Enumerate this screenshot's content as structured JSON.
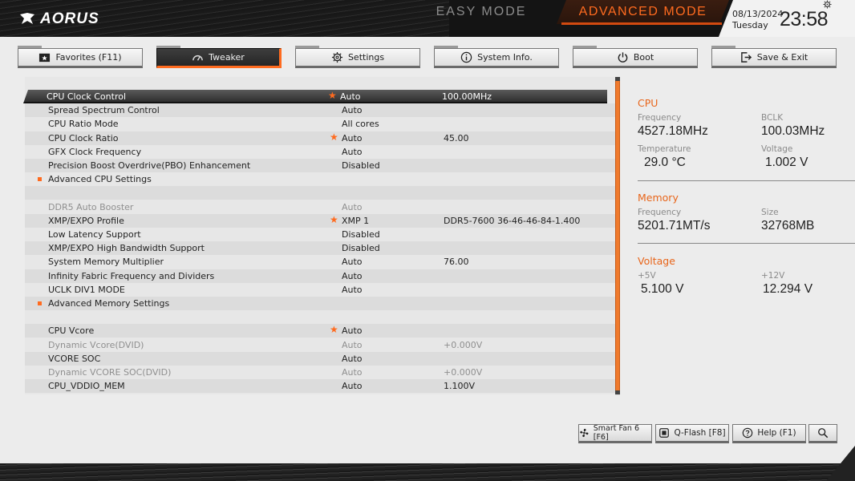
{
  "header": {
    "brand": "AORUS",
    "easy_mode_label": "EASY MODE",
    "advanced_mode_label": "ADVANCED MODE",
    "date": "08/13/2024",
    "weekday": "Tuesday",
    "time": "23:58"
  },
  "tabs": [
    {
      "label": "Favorites (F11)",
      "icon": "star-folder-icon"
    },
    {
      "label": "Tweaker",
      "icon": "gauge-icon",
      "active": true
    },
    {
      "label": "Settings",
      "icon": "gear-icon"
    },
    {
      "label": "System Info.",
      "icon": "info-icon"
    },
    {
      "label": "Boot",
      "icon": "power-icon"
    },
    {
      "label": "Save & Exit",
      "icon": "exit-icon"
    }
  ],
  "settings": [
    {
      "label": "CPU Clock Control",
      "value": "Auto",
      "extra": "100.00MHz",
      "star": true,
      "selected": true
    },
    {
      "label": "Spread Spectrum Control",
      "value": "Auto",
      "extra": ""
    },
    {
      "label": "CPU Ratio Mode",
      "value": "All cores",
      "extra": ""
    },
    {
      "label": "CPU Clock Ratio",
      "value": "Auto",
      "extra": "45.00",
      "star": true
    },
    {
      "label": "GFX Clock Frequency",
      "value": "Auto",
      "extra": ""
    },
    {
      "label": "Precision Boost Overdrive(PBO) Enhancement",
      "value": "Disabled",
      "extra": ""
    },
    {
      "label": "Advanced CPU Settings",
      "value": "",
      "extra": "",
      "submenu": true
    },
    {
      "label": "",
      "value": "",
      "extra": ""
    },
    {
      "label": "DDR5 Auto Booster",
      "value": "Auto",
      "extra": "",
      "dim": true
    },
    {
      "label": "XMP/EXPO Profile",
      "value": "XMP 1",
      "extra": "DDR5-7600 36-46-46-84-1.400",
      "star": true
    },
    {
      "label": "Low Latency Support",
      "value": "Disabled",
      "extra": ""
    },
    {
      "label": "XMP/EXPO High Bandwidth Support",
      "value": "Disabled",
      "extra": ""
    },
    {
      "label": "System Memory Multiplier",
      "value": "Auto",
      "extra": "76.00"
    },
    {
      "label": "Infinity Fabric Frequency and Dividers",
      "value": "Auto",
      "extra": ""
    },
    {
      "label": "UCLK DIV1 MODE",
      "value": "Auto",
      "extra": ""
    },
    {
      "label": "Advanced Memory Settings",
      "value": "",
      "extra": "",
      "submenu": true
    },
    {
      "label": "",
      "value": "",
      "extra": ""
    },
    {
      "label": "CPU Vcore",
      "value": "Auto",
      "extra": "",
      "star": true
    },
    {
      "label": "Dynamic Vcore(DVID)",
      "value": "Auto",
      "extra": "+0.000V",
      "dim": true
    },
    {
      "label": "VCORE SOC",
      "value": "Auto",
      "extra": ""
    },
    {
      "label": "Dynamic VCORE SOC(DVID)",
      "value": "Auto",
      "extra": "+0.000V",
      "dim": true
    },
    {
      "label": "CPU_VDDIO_MEM",
      "value": "Auto",
      "extra": "1.100V"
    }
  ],
  "monitor": {
    "cpu": {
      "title": "CPU",
      "frequency_label": "Frequency",
      "frequency": "4527.18MHz",
      "bclk_label": "BCLK",
      "bclk": "100.03MHz",
      "temperature_label": "Temperature",
      "temperature": "29.0 °C",
      "voltage_label": "Voltage",
      "voltage": "1.002 V"
    },
    "memory": {
      "title": "Memory",
      "frequency_label": "Frequency",
      "frequency": "5201.71MT/s",
      "size_label": "Size",
      "size": "32768MB"
    },
    "voltage": {
      "title": "Voltage",
      "v5_label": "+5V",
      "v5": "5.100 V",
      "v12_label": "+12V",
      "v12": "12.294 V"
    }
  },
  "footer_buttons": [
    {
      "label": "Smart Fan 6 [F6]",
      "icon": "fan-icon"
    },
    {
      "label": "Q-Flash [F8]",
      "icon": "chip-icon"
    },
    {
      "label": "Help (F1)",
      "icon": "help-icon"
    },
    {
      "label": "",
      "icon": "search-icon"
    }
  ],
  "colors": {
    "accent": "#ff6b1f",
    "header_bg": "#141414",
    "page_bg": "#ececec"
  }
}
